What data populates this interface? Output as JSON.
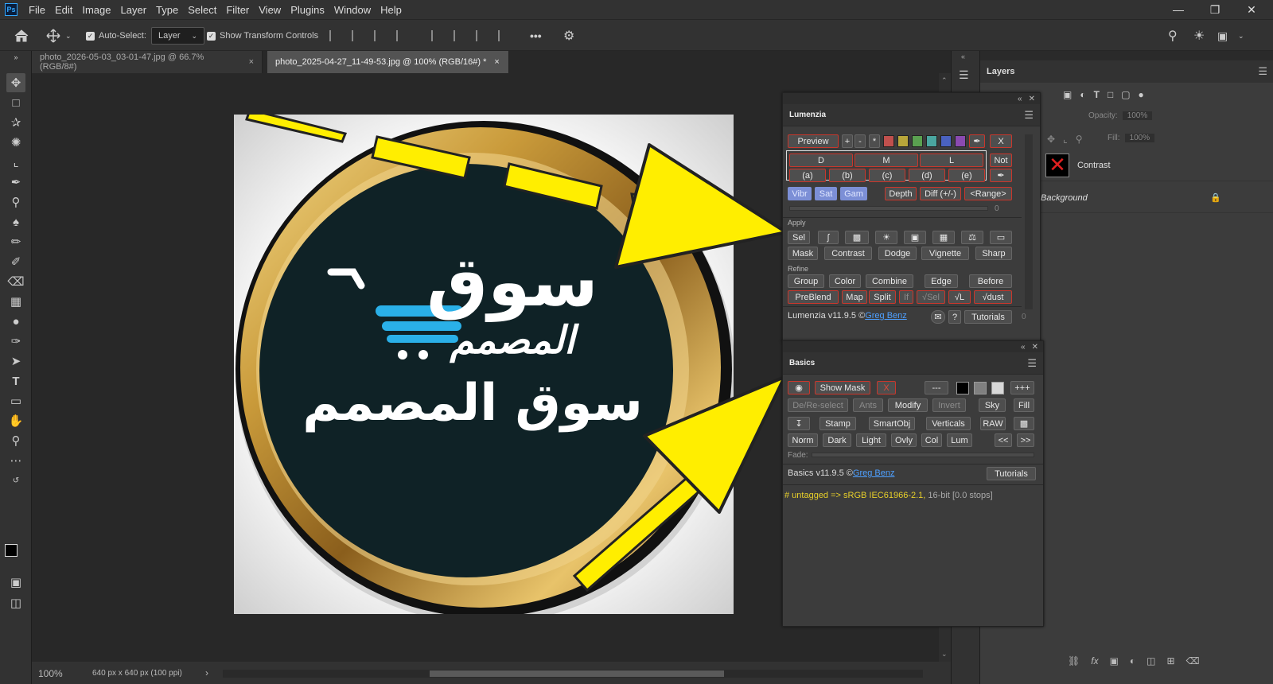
{
  "menubar": {
    "logo": "Ps",
    "items": [
      "File",
      "Edit",
      "Image",
      "Layer",
      "Type",
      "Select",
      "Filter",
      "View",
      "Plugins",
      "Window",
      "Help"
    ]
  },
  "options": {
    "auto_select_label": "Auto-Select:",
    "layer_dropdown": "Layer",
    "show_transform_label": "Show Transform Controls",
    "more": "•••"
  },
  "tabs": [
    {
      "label": "photo_2026-05-03_03-01-47.jpg @ 66.7% (RGB/8#)",
      "close": "×"
    },
    {
      "label": "photo_2025-04-27_11-49-53.jpg @ 100% (RGB/16#) *",
      "close": "×"
    }
  ],
  "status": {
    "zoom": "100%",
    "doc_info": "640 px x 640 px (100 ppi)",
    "arrow": "›"
  },
  "canvas_image": {
    "logo_top": "سوق",
    "logo_sub": "المصمم",
    "brand_text": "سوق المصمم",
    "colors": {
      "ring_gold": "#c99a3a",
      "disc": "#0f2226",
      "cart": "#2ab0e8",
      "arrow": "#ffee00",
      "bg": "#f0f0f0"
    }
  },
  "lumenzia": {
    "title": "Lumenzia",
    "row1": {
      "preview": "Preview",
      "plus": "+",
      "minus": "-",
      "star": "*",
      "x": "X"
    },
    "swatches": [
      "#c0504d",
      "#b8a63a",
      "#5aa050",
      "#4aa6a0",
      "#4a62c0",
      "#8a4ab0"
    ],
    "dml": [
      "D",
      "M",
      "L"
    ],
    "not": "Not",
    "letters": [
      "(a)",
      "(b)",
      "(c)",
      "(d)",
      "(e)"
    ],
    "vsg": [
      "Vibr",
      "Sat",
      "Gam"
    ],
    "depth": "Depth",
    "diff": "Diff (+/-)",
    "range": "<Range>",
    "slider_value": "0",
    "apply_label": "Apply",
    "sel": "Sel",
    "row_mask": [
      "Mask",
      "Contrast",
      "Dodge",
      "Vignette",
      "Sharp"
    ],
    "refine_label": "Refine",
    "row_group": [
      "Group",
      "Color",
      "Combine",
      "Edge",
      "Before"
    ],
    "row_preblend": [
      "PreBlend",
      "Map",
      "Split",
      "If",
      "√Sel",
      "√L",
      "√dust"
    ],
    "version": "Lumenzia v11.9.5 ©",
    "author": "Greg Benz",
    "help": "?",
    "tutorials": "Tutorials",
    "side_value": "0"
  },
  "basics": {
    "title": "Basics",
    "show_mask": "Show Mask",
    "x": "X",
    "dashes": "---",
    "plus3": "+++",
    "row2": [
      "De/Re-select",
      "Ants",
      "Modify",
      "Invert",
      "Sky",
      "Fill"
    ],
    "row3": [
      "Stamp",
      "SmartObj",
      "Verticals",
      "RAW"
    ],
    "row4": [
      "Norm",
      "Dark",
      "Light",
      "Ovly",
      "Col",
      "Lum"
    ],
    "prev": "<<",
    "next": ">>",
    "fade": "Fade:",
    "version": "Basics v11.9.5 ©",
    "author": "Greg Benz",
    "tutorials": "Tutorials",
    "profile_text": "# untagged => sRGB IEC61966-2.1,",
    "profile_suffix": " 16-bit [0.0 stops]"
  },
  "layers_panel": {
    "title": "Layers",
    "opacity_label": "Opacity:",
    "opacity_value": "100%",
    "fill_label": "Fill:",
    "fill_value": "100%",
    "layers": [
      {
        "name": "Contrast"
      },
      {
        "name": "Background"
      }
    ]
  }
}
